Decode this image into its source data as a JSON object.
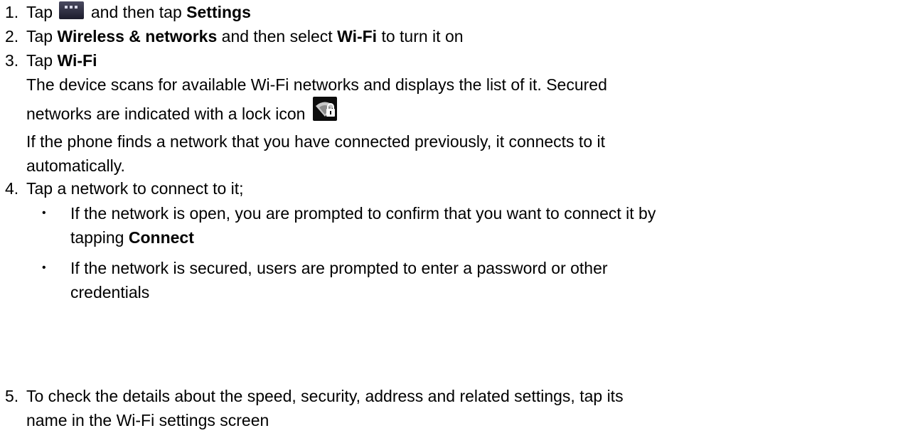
{
  "steps": [
    {
      "num": "1.",
      "parts": {
        "t1": "Tap",
        "t2": "and then tap",
        "b1": "Settings"
      },
      "icon": "apps-grid-icon"
    },
    {
      "num": "2.",
      "parts": {
        "t1": "Tap",
        "b1": "Wireless & networks",
        "t2": "and then select",
        "b2": "Wi-Fi",
        "t3": "to turn it on"
      }
    },
    {
      "num": "3.",
      "parts": {
        "t1": "Tap",
        "b1": "Wi-Fi"
      },
      "desc1": "The device scans for available Wi-Fi networks and displays the list of it. Secured",
      "desc2": "networks are indicated with a lock icon",
      "desc3": "If the phone finds a network that you have connected previously, it connects to it",
      "desc4": "automatically.",
      "icon": "wifi-lock-icon"
    },
    {
      "num": "4.",
      "text": "Tap a network to connect to it;",
      "bullets": [
        {
          "line1": "If the network is open, you are prompted to confirm that you want to connect it by",
          "line2_text": "tapping",
          "line2_bold": "Connect"
        },
        {
          "line1": "If the network is secured, users are prompted to enter a password or other",
          "line2_text": "credentials"
        }
      ]
    },
    {
      "num": "5.",
      "line1": "To check the details about the speed, security, address and related settings, tap its",
      "line2": "name in the Wi-Fi settings screen"
    }
  ],
  "bullet_glyph": "•"
}
